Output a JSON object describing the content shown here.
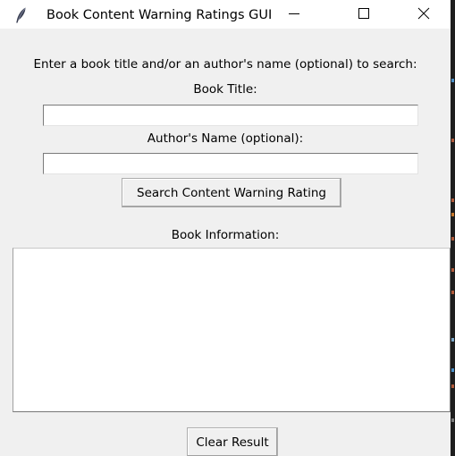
{
  "window": {
    "title": "Book Content Warning Ratings GUI",
    "icon": "feather-icon",
    "controls": {
      "minimize_icon": "minimize-icon",
      "maximize_icon": "maximize-icon",
      "close_icon": "close-icon"
    }
  },
  "form": {
    "instructions": "Enter a book title and/or an author's name (optional) to search:",
    "title_label": "Book Title:",
    "title_value": "",
    "author_label": "Author's Name (optional):",
    "author_value": "",
    "search_button": "Search Content Warning Rating"
  },
  "results": {
    "label": "Book Information:",
    "content": "",
    "clear_button": "Clear Result"
  },
  "colors": {
    "window_bg": "#f0f0f0",
    "titlebar_bg": "#ffffff",
    "field_bg": "#ffffff"
  }
}
